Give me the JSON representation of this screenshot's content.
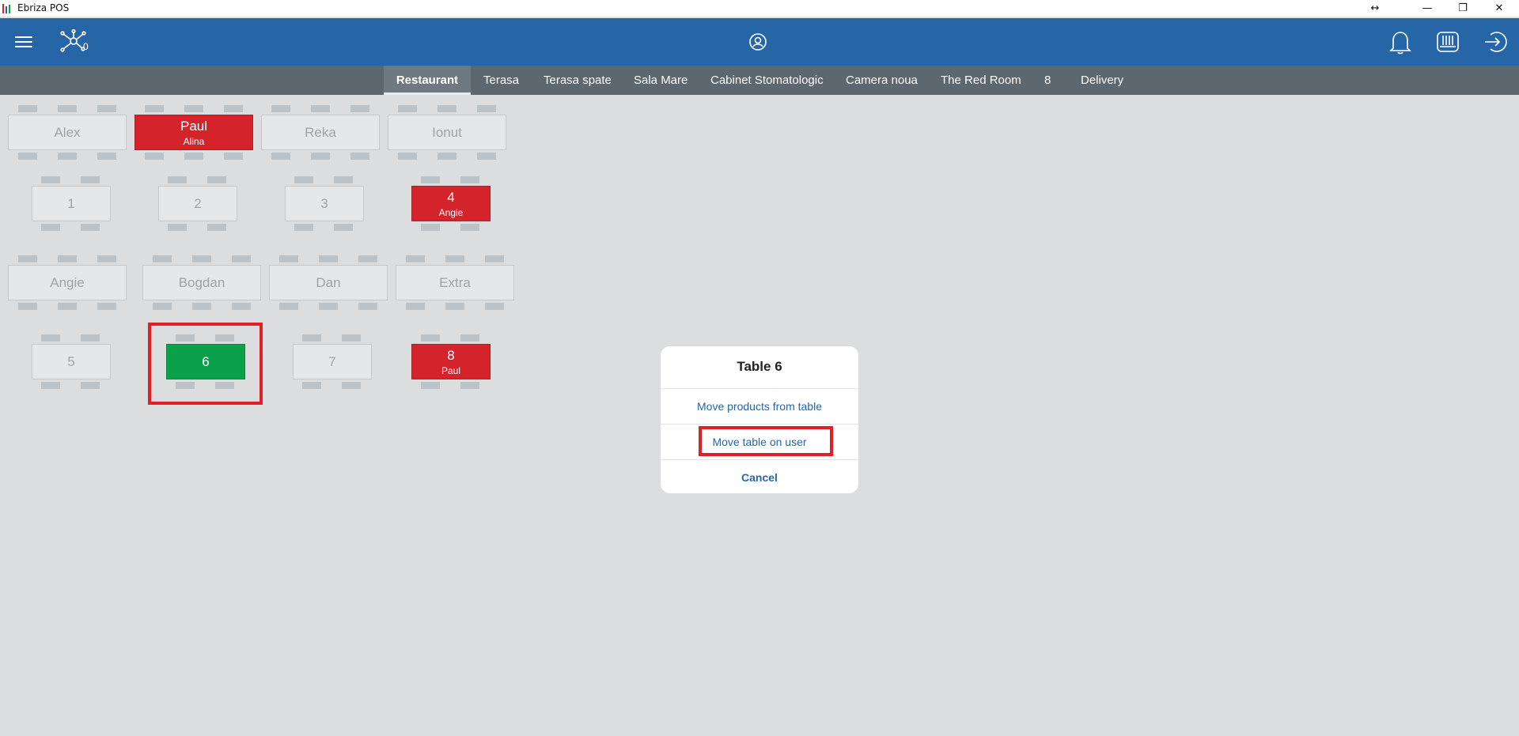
{
  "window": {
    "title": "Ebriza POS",
    "controls": {
      "resize": "↔",
      "minimize": "—",
      "restore": "❐",
      "close": "✕"
    }
  },
  "header": {
    "left_icons": [
      "menu-icon",
      "network-icon"
    ],
    "network_badge": "0",
    "center_icon": "user-circle-icon",
    "right_icons": [
      "bell-icon",
      "drawer-icon",
      "logout-icon"
    ],
    "color": "#2766a6"
  },
  "tabs": [
    {
      "label": "Restaurant",
      "active": true
    },
    {
      "label": "Terasa"
    },
    {
      "label": "Terasa spate"
    },
    {
      "label": "Sala Mare"
    },
    {
      "label": "Cabinet Stomatologic"
    },
    {
      "label": "Camera noua"
    },
    {
      "label": "The Red Room"
    },
    {
      "label": "8"
    },
    {
      "label": "Delivery"
    }
  ],
  "tables": [
    {
      "name": "Alex",
      "status": "free"
    },
    {
      "name": "Paul",
      "user": "Alina",
      "status": "occupied"
    },
    {
      "name": "Reka",
      "status": "free"
    },
    {
      "name": "Ionut",
      "status": "free"
    },
    {
      "name": "1",
      "status": "free"
    },
    {
      "name": "2",
      "status": "free"
    },
    {
      "name": "3",
      "status": "free"
    },
    {
      "name": "4",
      "user": "Angie",
      "status": "occupied"
    },
    {
      "name": "Angie",
      "status": "free"
    },
    {
      "name": "Bogdan",
      "status": "free"
    },
    {
      "name": "Dan",
      "status": "free"
    },
    {
      "name": "Extra",
      "status": "free"
    },
    {
      "name": "5",
      "status": "free"
    },
    {
      "name": "6",
      "status": "selected"
    },
    {
      "name": "7",
      "status": "free"
    },
    {
      "name": "8",
      "user": "Paul",
      "status": "occupied"
    }
  ],
  "colors": {
    "occupied": "#d5232b",
    "selected": "#0aa14b",
    "free": "#e6e7e8",
    "highlight": "#e11f26"
  },
  "dialog": {
    "title": "Table 6",
    "option_move_products": "Move products from table",
    "option_move_table_user": "Move table on user",
    "cancel": "Cancel"
  }
}
